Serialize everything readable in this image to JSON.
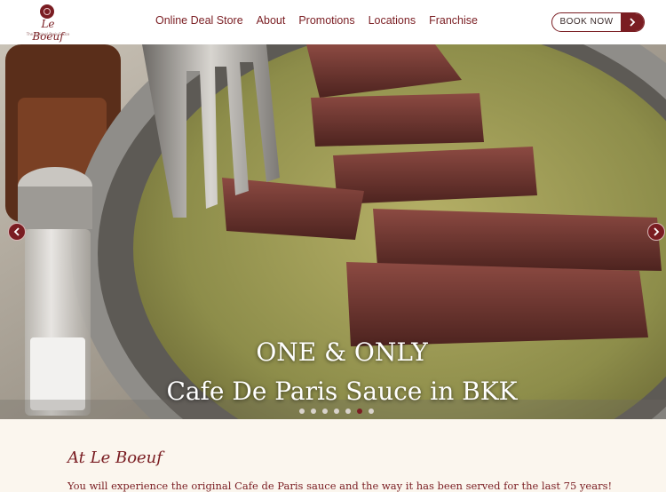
{
  "brand": {
    "name": "Le Boeuf",
    "tagline": "The Original Paris Sauce"
  },
  "nav": {
    "items": [
      {
        "label": "Online Deal Store"
      },
      {
        "label": "About"
      },
      {
        "label": "Promotions"
      },
      {
        "label": "Locations"
      },
      {
        "label": "Franchise"
      }
    ],
    "book_label": "BOOK NOW"
  },
  "hero": {
    "line1": "ONE & ONLY",
    "line2": "Cafe De Paris Sauce in BKK",
    "slide_count": 7,
    "active_slide": 6
  },
  "about": {
    "title": "At Le Boeuf",
    "text": "You will experience the original Cafe de Paris sauce and the way it has been served for the last 75 years!"
  },
  "colors": {
    "accent": "#7a1d22",
    "background": "#fbf6ee"
  }
}
